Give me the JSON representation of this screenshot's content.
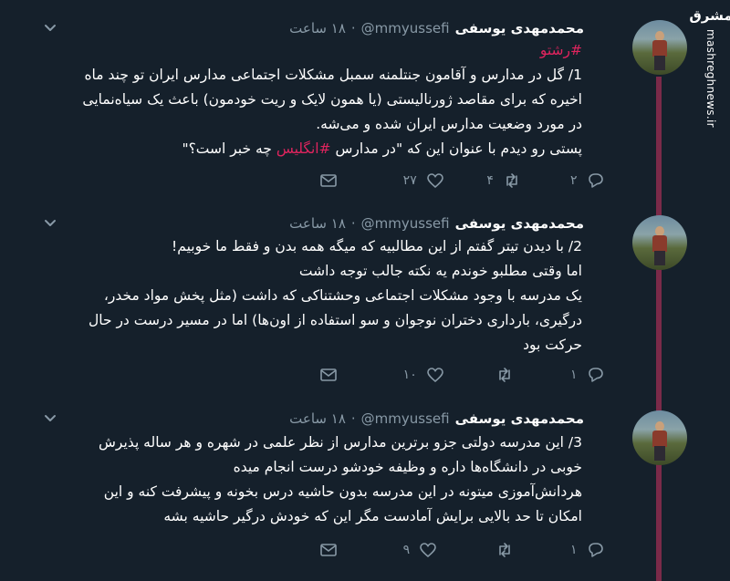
{
  "watermark": {
    "logo": "مشرق",
    "url": "mashreghnews.ir"
  },
  "tweets": [
    {
      "name": "محمدمهدی یوسفی",
      "handle": "@mmyussefi",
      "time": "۱۸ ساعت",
      "lines": [
        "#رشتو",
        "1/ گل در مدارس و آقامون جنتلمنه سمبل مشکلات اجتماعی مدارس ایران تو چند ماه",
        "اخیره که برای مقاصد ژورنالیستی (یا همون لایک و ریت خودمون) باعث یک سیاه‌نمایی",
        "در مورد وضعیت مدارس ایران شده و می‌شه.",
        "پستی رو دیدم با عنوان این که \"در مدارس #انگلیس چه خبر است؟\""
      ],
      "hashtag_top": "#رشتو",
      "line5_pre": "پستی رو دیدم با عنوان این که \"در مدارس ",
      "line5_tag": "#انگلیس",
      "line5_post": " چه خبر است؟\"",
      "replies": "۲",
      "retweets": "۴",
      "likes": "۲۷"
    },
    {
      "name": "محمدمهدی یوسفی",
      "handle": "@mmyussefi",
      "time": "۱۸ ساعت",
      "lines": [
        "2/ با دیدن تیتر گفتم از این مطالبیه که میگه همه بدن و فقط ما خوبیم!",
        "اما وقتی مطلبو خوندم یه نکته جالب توجه داشت",
        "یک مدرسه با وجود مشکلات اجتماعی وحشتناکی که داشت (مثل پخش مواد مخدر،",
        "درگیری، بارداری دختران نوجوان و سو استفاده از اون‌ها) اما در مسیر درست در حال",
        "حرکت بود"
      ],
      "replies": "۱",
      "retweets": "",
      "likes": "۱۰"
    },
    {
      "name": "محمدمهدی یوسفی",
      "handle": "@mmyussefi",
      "time": "۱۸ ساعت",
      "lines": [
        "3/ این مدرسه دولتی جزو برترین مدارس از نظر علمی در شهره و هر ساله پذیرش",
        "خوبی در دانشگاه‌ها داره و وظیفه خودشو درست انجام میده",
        "هردانش‌آموزی میتونه در این مدرسه بدون حاشیه درس بخونه و پیشرفت کنه و این",
        "امکان تا حد بالایی برایش آمادست مگر این که خودش درگیر حاشیه بشه"
      ],
      "replies": "۱",
      "retweets": "",
      "likes": "۹"
    }
  ],
  "icons": [
    "chevron-down-icon",
    "mail-icon",
    "heart-icon",
    "retweet-icon",
    "reply-icon"
  ],
  "colors": {
    "background": "#15202b",
    "muted": "#8899a6",
    "hashtag": "#e0245e",
    "thread": "#7a2a49"
  }
}
